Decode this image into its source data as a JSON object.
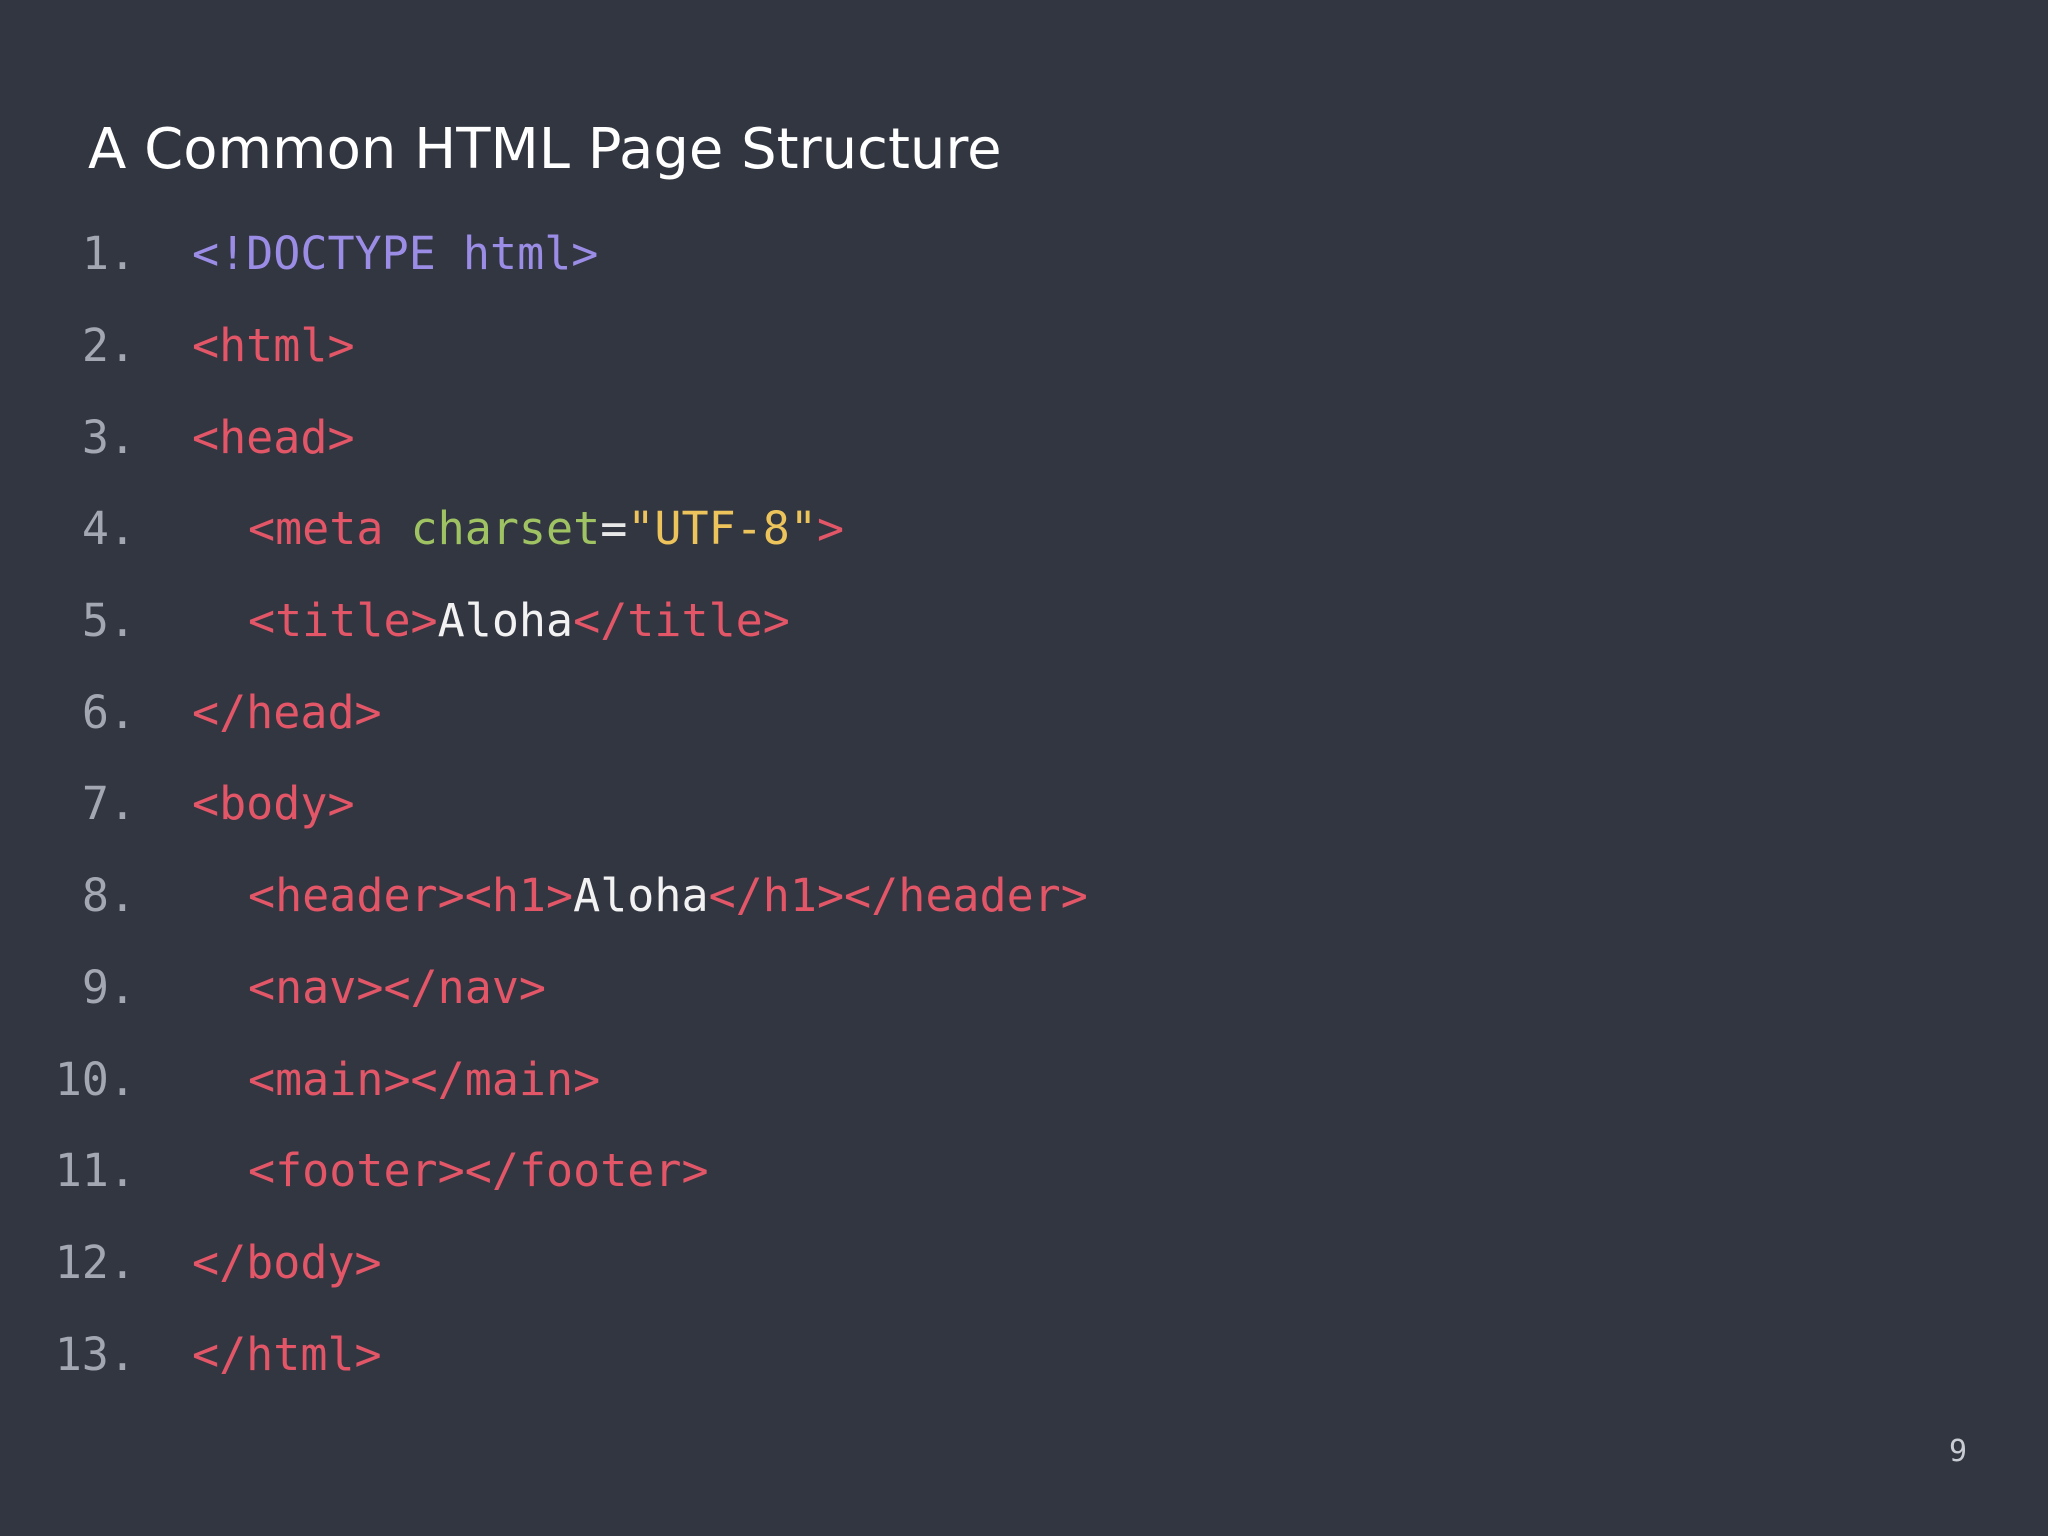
{
  "slide": {
    "title": "A Common HTML Page Structure",
    "page_number": "9"
  },
  "code": {
    "lines": [
      {
        "number": "1.",
        "tokens": [
          {
            "type": "doctype",
            "text": "<!DOCTYPE html>"
          }
        ]
      },
      {
        "number": "2.",
        "tokens": [
          {
            "type": "tag",
            "text": "<html>"
          }
        ]
      },
      {
        "number": "3.",
        "tokens": [
          {
            "type": "tag",
            "text": "<head>"
          }
        ]
      },
      {
        "number": "4.",
        "tokens": [
          {
            "type": "tag",
            "text": "<meta"
          },
          {
            "type": "space",
            "text": " "
          },
          {
            "type": "attr",
            "text": "charset"
          },
          {
            "type": "eq",
            "text": "="
          },
          {
            "type": "str",
            "text": "\"UTF-8\""
          },
          {
            "type": "tag",
            "text": ">"
          }
        ]
      },
      {
        "number": "5.",
        "tokens": [
          {
            "type": "tag",
            "text": "<title>"
          },
          {
            "type": "text",
            "text": "Aloha"
          },
          {
            "type": "tag",
            "text": "</title>"
          }
        ]
      },
      {
        "number": "6.",
        "tokens": [
          {
            "type": "tag",
            "text": "</head>"
          }
        ]
      },
      {
        "number": "7.",
        "tokens": [
          {
            "type": "tag",
            "text": "<body>"
          }
        ]
      },
      {
        "number": "8.",
        "tokens": [
          {
            "type": "tag",
            "text": "<header><h1>"
          },
          {
            "type": "text",
            "text": "Aloha"
          },
          {
            "type": "tag",
            "text": "</h1></header>"
          }
        ]
      },
      {
        "number": "9.",
        "tokens": [
          {
            "type": "tag",
            "text": "<nav></nav>"
          }
        ]
      },
      {
        "number": "10.",
        "tokens": [
          {
            "type": "tag",
            "text": "<main></main>"
          }
        ]
      },
      {
        "number": "11.",
        "tokens": [
          {
            "type": "tag",
            "text": "<footer></footer>"
          }
        ]
      },
      {
        "number": "12.",
        "tokens": [
          {
            "type": "tag",
            "text": "</body>"
          }
        ]
      },
      {
        "number": "13.",
        "tokens": [
          {
            "type": "tag",
            "text": "</html>"
          }
        ]
      }
    ]
  },
  "colors": {
    "background": "#323641",
    "title": "#ffffff",
    "line_number": "#a2a7b2",
    "tag": "#e25667",
    "doctype": "#9b8ce6",
    "attribute": "#9fc362",
    "string": "#edc45b",
    "text": "#f2f2f2"
  }
}
